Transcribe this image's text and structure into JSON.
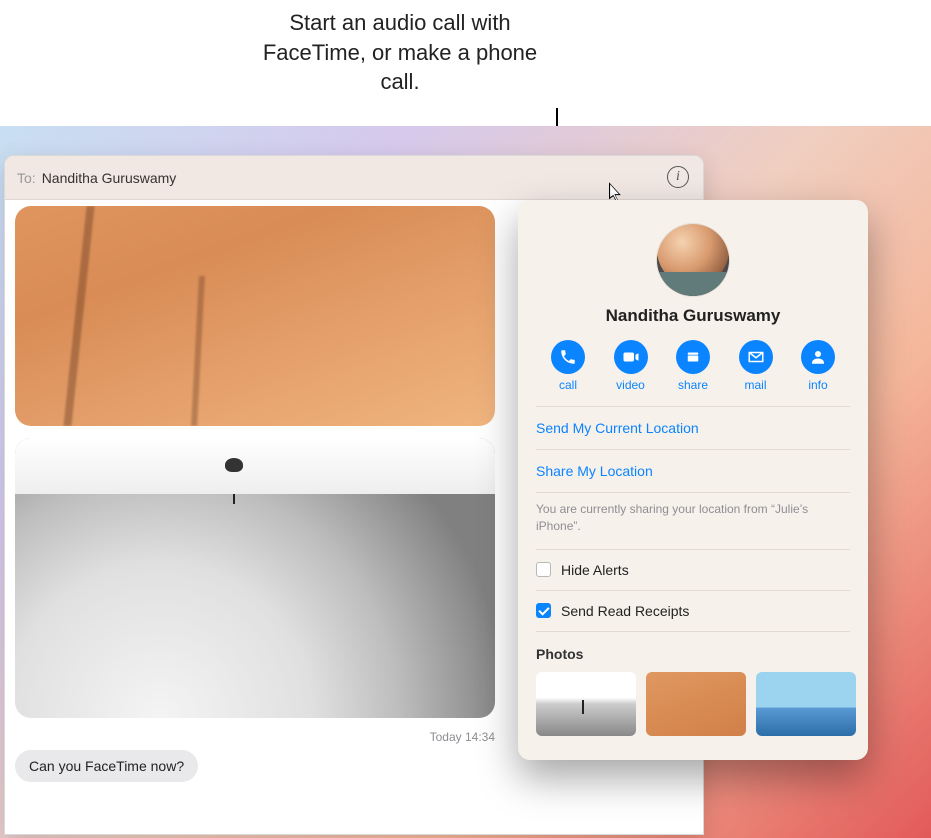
{
  "callout": "Start an audio call with FaceTime, or make a phone call.",
  "toBar": {
    "label": "To:",
    "recipient": "Nanditha Guruswamy"
  },
  "chat": {
    "timestamp": "Today 14:34",
    "message1": "Can you FaceTime now?"
  },
  "popover": {
    "contactName": "Nanditha Guruswamy",
    "actions": {
      "call": "call",
      "video": "video",
      "share": "share",
      "mail": "mail",
      "info": "info"
    },
    "sendCurrentLocation": "Send My Current Location",
    "shareMyLocation": "Share My Location",
    "sharingNote": "You are currently sharing your location from “Julie’s iPhone”.",
    "hideAlerts": {
      "label": "Hide Alerts",
      "checked": false
    },
    "sendReadReceipts": {
      "label": "Send Read Receipts",
      "checked": true
    },
    "photosHeader": "Photos"
  }
}
